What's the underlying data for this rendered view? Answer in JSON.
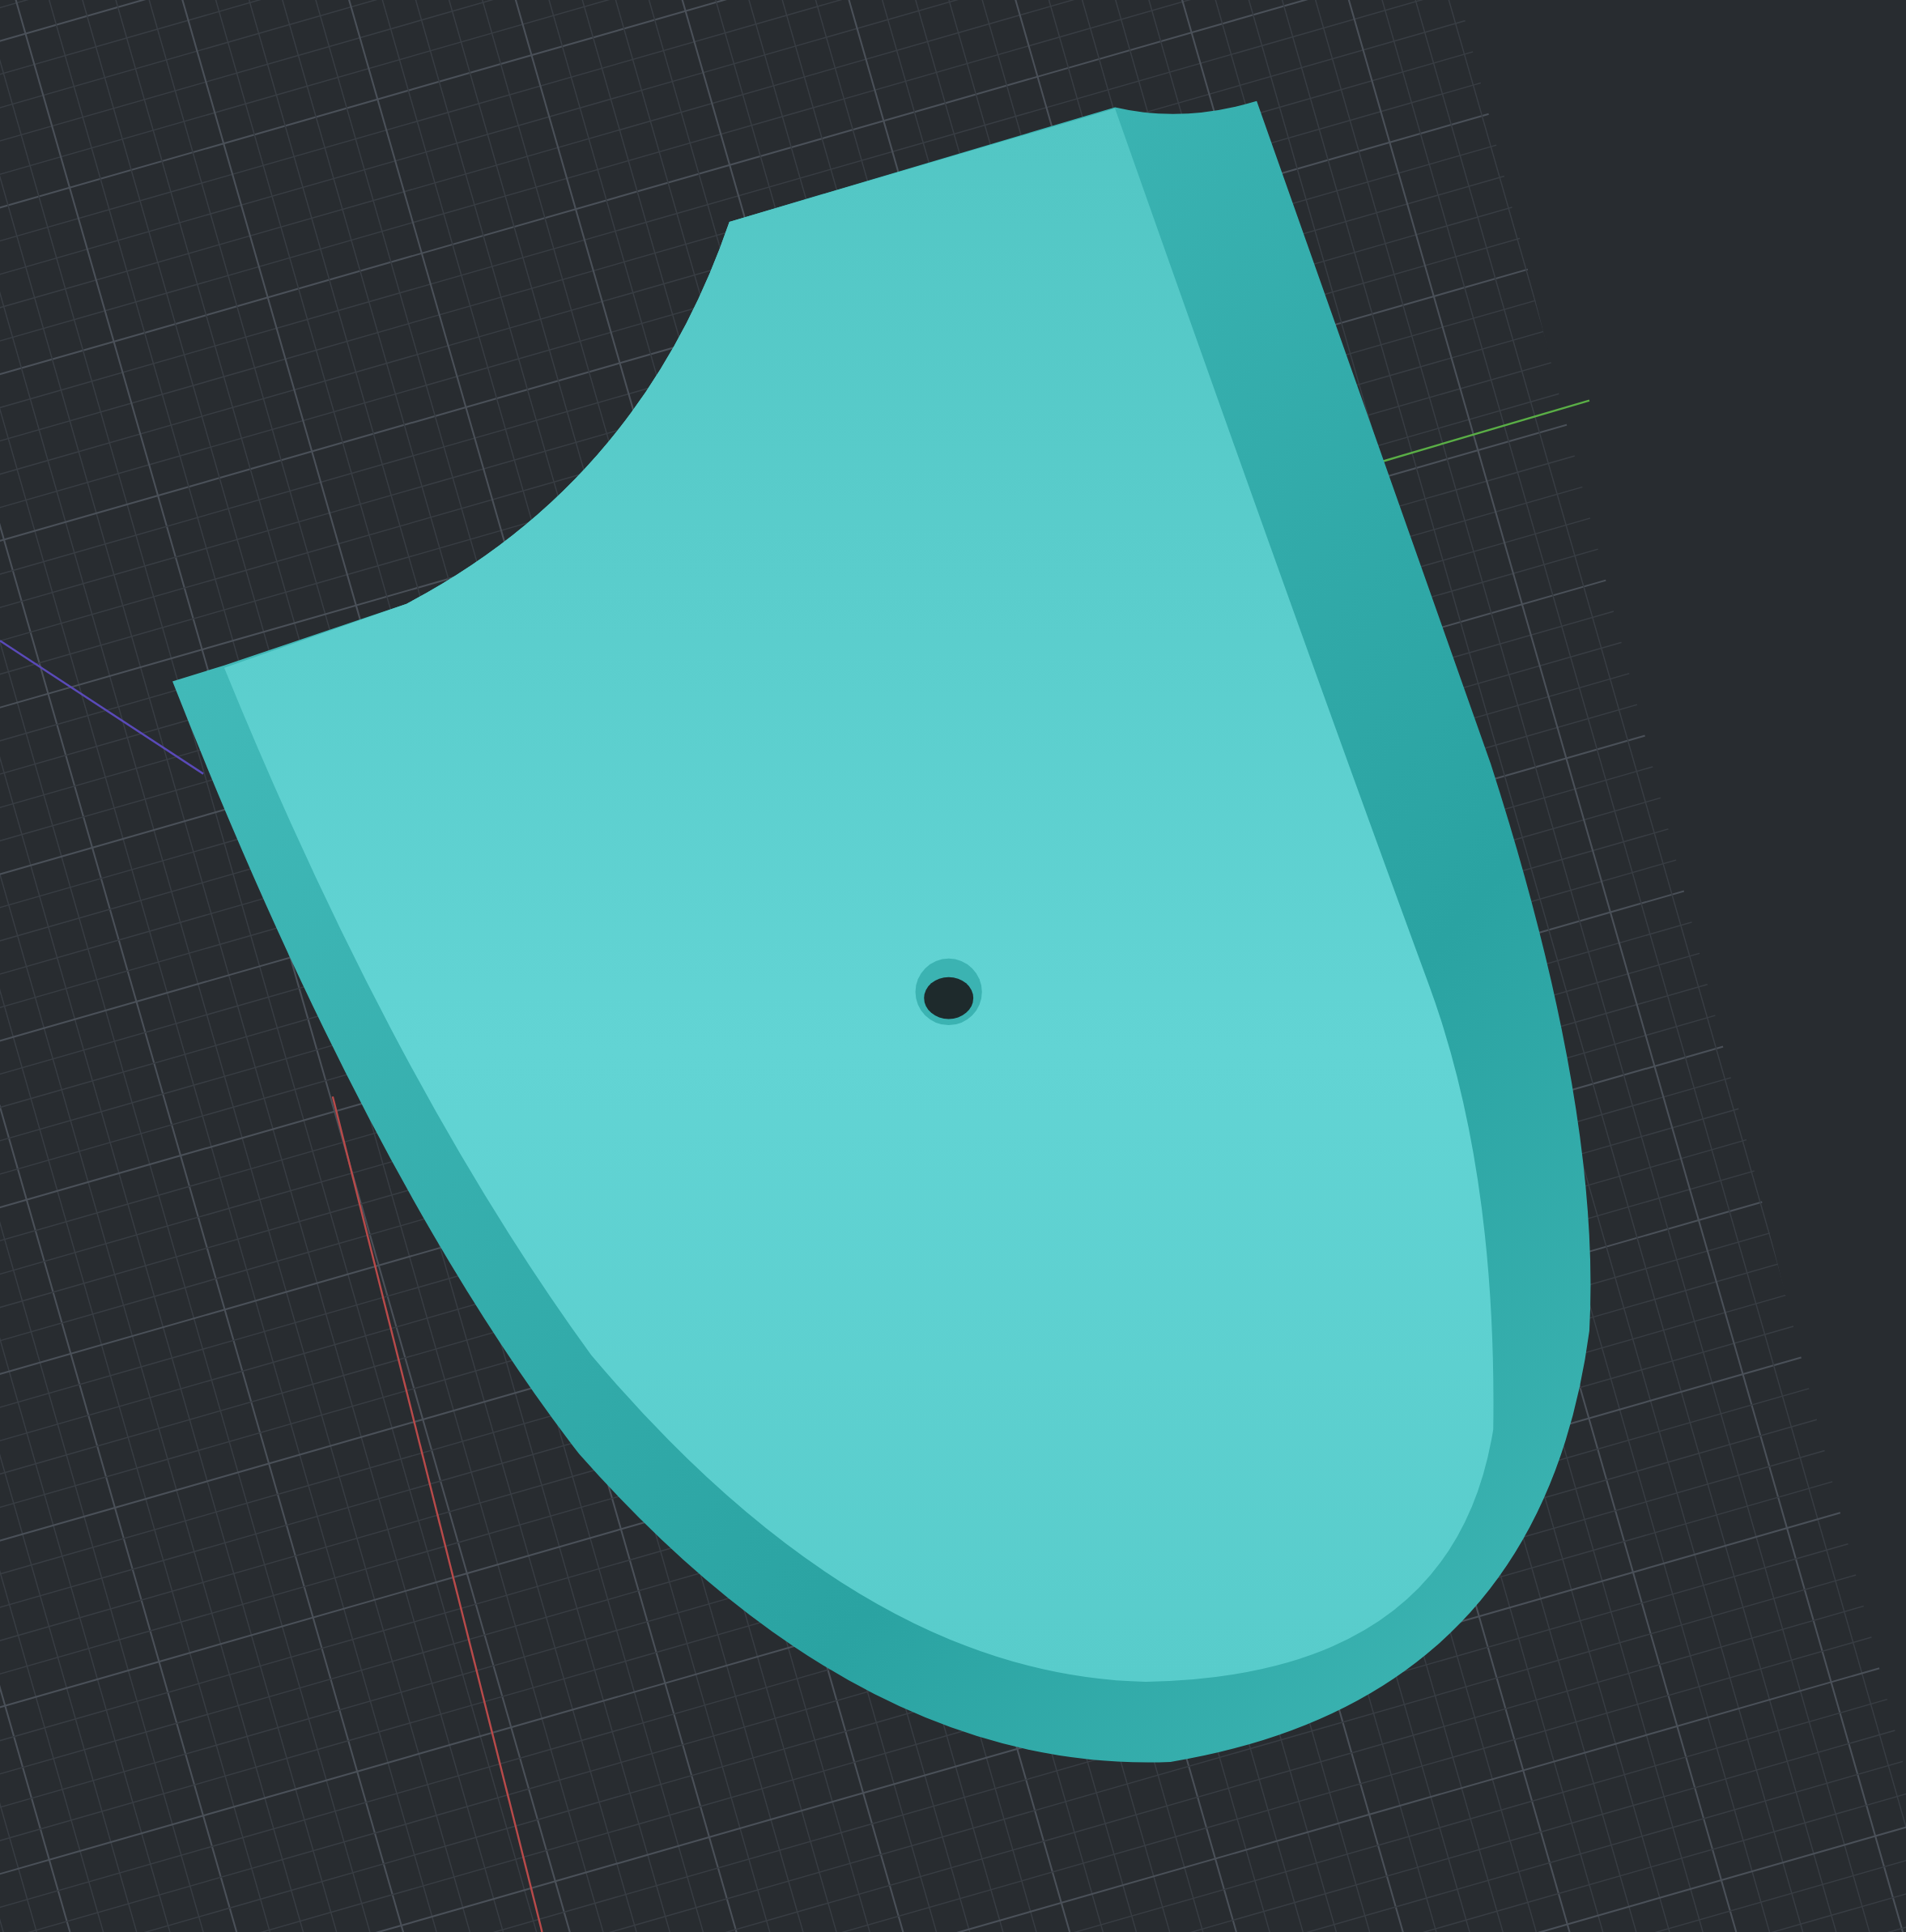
{
  "viewport": {
    "kind": "model",
    "axes": [
      {
        "kind": "x",
        "color": "#b84a4a"
      },
      {
        "kind": "y",
        "color": "#5aae46"
      },
      {
        "kind": "z",
        "color": "#5a4ab8"
      }
    ]
  }
}
